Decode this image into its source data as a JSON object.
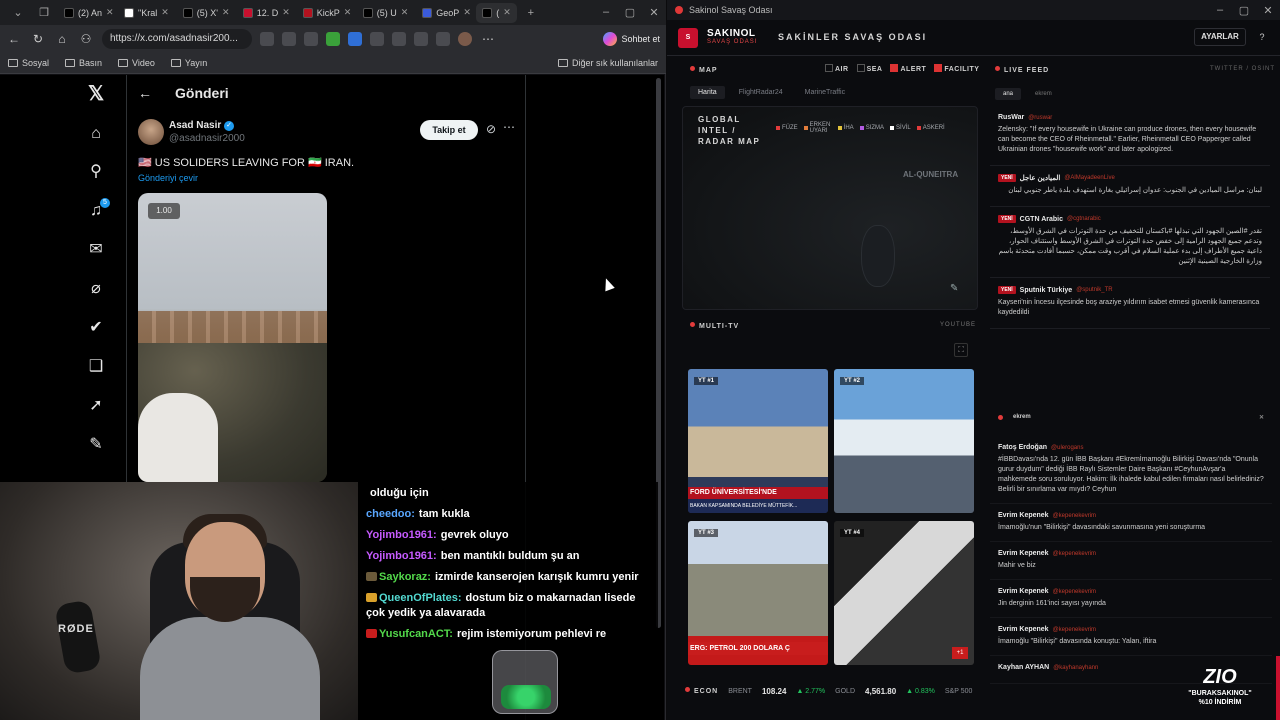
{
  "browser": {
    "tabs": [
      {
        "label": "(2) An",
        "color": "#000000"
      },
      {
        "label": "\"Kral",
        "color": "#ffffff"
      },
      {
        "label": "(5) X'",
        "color": "#000000"
      },
      {
        "label": "12. D",
        "color": "#c8102e"
      },
      {
        "label": "KickP",
        "color": "#b3121f"
      },
      {
        "label": "(5) U",
        "color": "#000000"
      },
      {
        "label": "GeoP",
        "color": "#3b5bdb"
      },
      {
        "label": "(",
        "color": "#000000"
      }
    ],
    "url": "https://x.com/asadnasir200...",
    "copilot_label": "Sohbet et",
    "bookmarks": [
      "Sosyal",
      "Basın",
      "Video",
      "Yayın"
    ],
    "other_bookmarks": "Diğer sık kullanılanlar"
  },
  "x": {
    "header_title": "Gönderi",
    "author_name": "Asad Nasir",
    "author_handle": "@asadnasir2000",
    "follow_label": "Takip et",
    "post_text": "🇺🇸 US SOLIDERS LEAVING FOR 🇮🇷 IRAN.",
    "translate_label": "Gönderiyi çevir",
    "video_speed": "1.00",
    "notifications_count": "5"
  },
  "webcam": {
    "mic_brand": "RØDE"
  },
  "chat": [
    {
      "user": "",
      "text": "olduğu için",
      "color": "#ffffff",
      "badge": ""
    },
    {
      "user": "cheedoo:",
      "text": "tam kukla",
      "color": "#5aa7ff",
      "badge": ""
    },
    {
      "user": "Yojimbo1961:",
      "text": "gevrek oluyo",
      "color": "#c65bff",
      "badge": ""
    },
    {
      "user": "Yojimbo1961:",
      "text": "ben mantıklı buldum şu an",
      "color": "#c65bff",
      "badge": ""
    },
    {
      "user": "Saykoraz:",
      "text": "izmirde kanserojen karışık kumru yenir",
      "color": "#53d94b",
      "badge": "#6b5a3a"
    },
    {
      "user": "QueenOfPlates:",
      "text": "dostum biz o makarnadan lisede çok yedik ya alavarada",
      "color": "#53d9d1",
      "badge": "#d9a12b"
    },
    {
      "user": "YusufcanACT:",
      "text": "rejim istemiyorum pehlevi re",
      "color": "#53d94b",
      "badge": "#c81d1d"
    }
  ],
  "dashboard": {
    "window_title": "Sakinol Savaş Odası",
    "brand": "SAKINOL",
    "brand_sub": "SAVAŞ ODASI",
    "room_title": "SAKİNLER SAVAŞ ODASI",
    "settings_label": "AYARLAR",
    "help_label": "?",
    "map_section": "MAP",
    "filters": [
      {
        "label": "AIR",
        "on": false
      },
      {
        "label": "SEA",
        "on": false
      },
      {
        "label": "ALERT",
        "on": true
      },
      {
        "label": "FACILITY",
        "on": true
      }
    ],
    "map_tabs": [
      "Harita",
      "FlightRadar24",
      "MarineTraffic"
    ],
    "map_title": "GLOBAL INTEL / RADAR MAP",
    "legend": [
      {
        "label": "FÜZE",
        "color": "#e23b3b"
      },
      {
        "label": "ERKEN UYARI",
        "color": "#e27d3b"
      },
      {
        "label": "İHA",
        "color": "#e2c23b"
      },
      {
        "label": "SIZMA",
        "color": "#b35be2"
      },
      {
        "label": "SİVİL",
        "color": "#ffffff"
      },
      {
        "label": "ASKERİ",
        "color": "#e23b3b"
      }
    ],
    "map_place": "AL-QUNEITRA",
    "tv_section": "MULTI-TV",
    "tv_source": "YOUTUBE",
    "tvs": [
      {
        "tag": "YT #1",
        "ticker": "FORD ÜNİVERSİTESİ'NDE",
        "bottom": "BAKAN KAPSAMINDA BELEDİYE MÜTTEFİK..."
      },
      {
        "tag": "YT #2"
      },
      {
        "tag": "YT #3",
        "ticker": "ERG: PETROL 200 DOLARA Ç"
      },
      {
        "tag": "YT #4",
        "plus": "+1"
      }
    ],
    "econ": {
      "label": "ECON",
      "brent_label": "BRENT",
      "brent_value": "108.24",
      "brent_change": "▲ 2.77%",
      "gold_label": "GOLD",
      "gold_value": "4,561.80",
      "gold_change": "▲ 0.83%",
      "sp_label": "S&P 500"
    },
    "live_section": "LIVE FEED",
    "live_right": "TWITTER / OSINT",
    "feed_tabs": [
      "ana",
      "ekrem"
    ],
    "feed": [
      {
        "new": "",
        "source": "RusWar",
        "handle": "@ruswar",
        "time": "",
        "rtl": false,
        "text": "Zelensky: \"If every housewife in Ukraine can produce drones, then every housewife can become the CEO of Rheinmetall.\" Earlier, Rheinmetall CEO Papperger called Ukrainian drones \"housewife work\" and later apologized."
      },
      {
        "new": "YENİ",
        "source": "الميادين عاجل",
        "handle": "@AlMayadeenLive",
        "time": "",
        "rtl": true,
        "text": "لبنان: مراسل الميادين في الجنوب: عدوان إسرائيلي بغارة استهدف بلدة ياطر جنوبي لبنان"
      },
      {
        "new": "YENİ",
        "source": "CGTN Arabic",
        "handle": "@cgtnarabic",
        "time": "",
        "rtl": true,
        "text": "تقدر #الصين الجهود التي تبذلها #باكستان للتخفيف من حدة التوترات في الشرق الأوسط، وتدعم جميع الجهود الرامية إلى خفض حدة التوترات في الشرق الأوسط واستئناف الحوار، داعية جميع الأطراف إلى بدء عملية السلام في أقرب وقت ممكن، حسبما أفادت متحدثة باسم وزارة الخارجية الصينية الإثنين"
      },
      {
        "new": "YENİ",
        "source": "Sputnik Türkiye",
        "handle": "@sputnik_TR",
        "time": "",
        "rtl": false,
        "text": "Kayseri'nin İncesu ilçesinde boş araziye yıldırım isabet etmesi güvenlik kamerasınca kaydedildi"
      }
    ],
    "ekrem_section": "ekrem",
    "ekrem_feed": [
      {
        "source": "Fatoş Erdoğan",
        "handle": "@ulerogans",
        "text": "#İBBDavası'nda 12. gün İBB Başkanı #Ekremİmamoğlu Bilirkişi Davası'nda \"Onunla gurur duydum\" dediği İBB Raylı Sistemler Daire Başkanı #CeyhunAvşar'a mahkemede soru soruluyor. Hakim: İlk ihalede kabul edilen firmaları nasıl belirlediniz? Belirli bir sınırlama var mıydı? Ceyhun"
      },
      {
        "source": "Evrim Kepenek",
        "handle": "@kepenekevrim",
        "text": "İmamoğlu'nun \"Bilirkişi\" davasındaki savunmasına yeni soruşturma"
      },
      {
        "source": "Evrim Kepenek",
        "handle": "@kepenekevrim",
        "text": "Mahir ve biz"
      },
      {
        "source": "Evrim Kepenek",
        "handle": "@kepenekevrim",
        "text": "Jin derginin 161'inci sayısı yayında"
      },
      {
        "source": "Evrim Kepenek",
        "handle": "@kepenekevrim",
        "text": "İmamoğlu \"Bilirkişi\" davasında konuştu: Yalan, iftira"
      },
      {
        "source": "Kayhan AYHAN",
        "handle": "@kayhanayhann",
        "text": ""
      }
    ],
    "promo_logo": "ZIO",
    "promo_code": "\"BURAKSAKINOL\"",
    "promo_discount": "%10 İNDİRİM"
  }
}
